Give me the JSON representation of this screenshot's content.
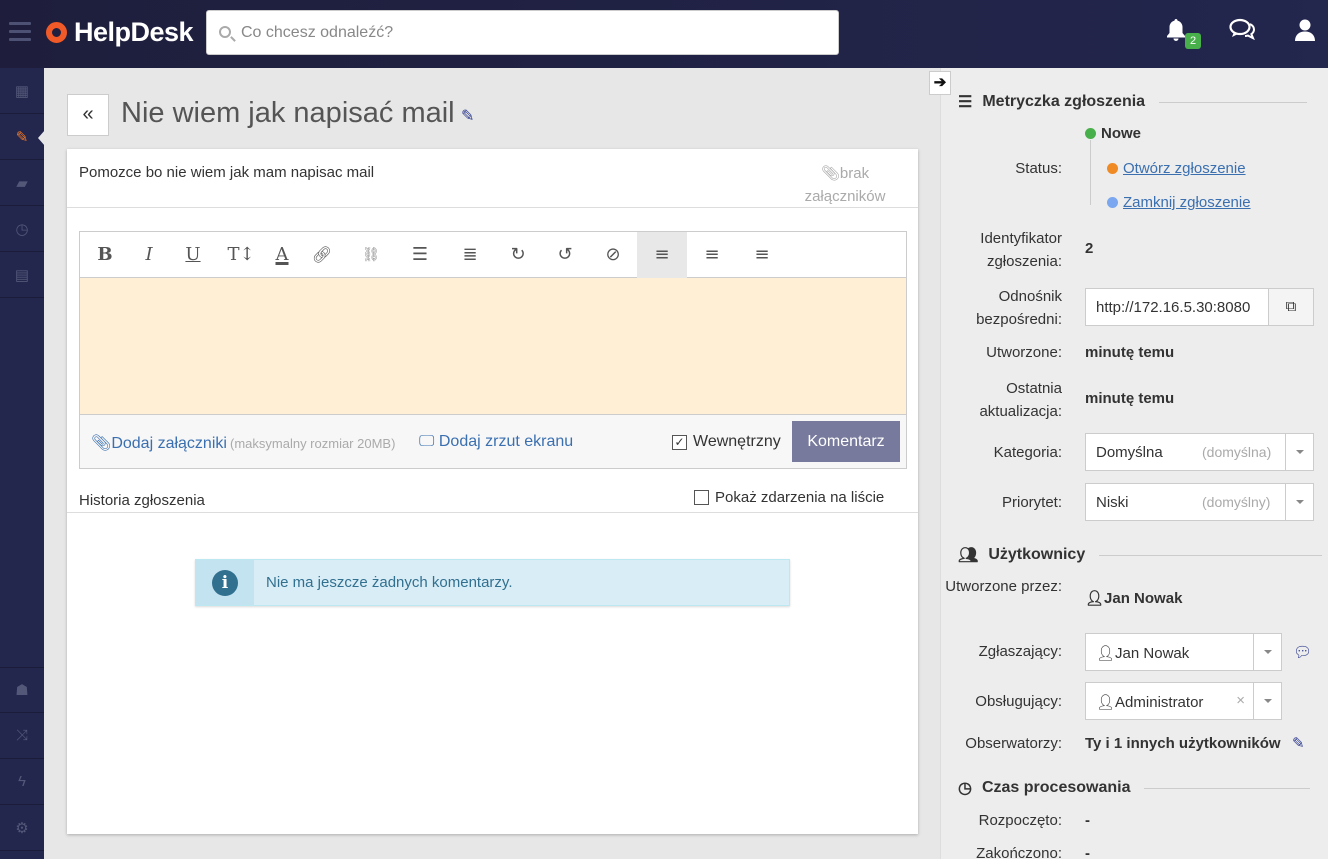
{
  "app": {
    "name": "HelpDesk",
    "notifications_count": "2"
  },
  "search": {
    "placeholder": "Co chcesz odnaleźć?"
  },
  "ticket": {
    "title": "Nie wiem jak napisać mail",
    "description": "Pomozce bo nie wiem jak mam napisac mail",
    "no_attachments": "brak załączników"
  },
  "editor": {
    "toolbar": [
      "B",
      "I",
      "U",
      "T↕",
      "A",
      "link",
      "unlink",
      "bullets",
      "numbers",
      "redo",
      "undo",
      "clear",
      "align-left",
      "align-center",
      "align-right"
    ],
    "add_attachments": "Dodaj załączniki",
    "max_size": "(maksymalny rozmiar 20MB)",
    "add_screenshot": "Dodaj zrzut ekranu",
    "internal_label": "Wewnętrzny",
    "internal_checked": true,
    "comment_button": "Komentarz"
  },
  "history": {
    "label": "Historia zgłoszenia",
    "show_events": "Pokaż zdarzenia na liście",
    "empty_message": "Nie ma jeszcze żadnych komentarzy."
  },
  "metrics": {
    "heading": "Metryczka zgłoszenia",
    "status_label": "Status:",
    "status_current": "Nowe",
    "status_open": "Otwórz zgłoszenie",
    "status_close": "Zamknij zgłoszenie",
    "id_label": "Identyfikator zgłoszenia:",
    "id_value": "2",
    "link_label": "Odnośnik bezpośredni:",
    "link_value": "http://172.16.5.30:8080",
    "created_label": "Utworzone:",
    "created_value": "minutę temu",
    "updated_label": "Ostatnia aktualizacja:",
    "updated_value": "minutę temu",
    "category_label": "Kategoria:",
    "category_value": "Domyślna",
    "category_hint": "(domyślna)",
    "priority_label": "Priorytet:",
    "priority_value": "Niski",
    "priority_hint": "(domyślny)"
  },
  "users": {
    "heading": "Użytkownicy",
    "created_by_label": "Utworzone przez:",
    "created_by_value": "Jan Nowak",
    "reporter_label": "Zgłaszający:",
    "reporter_value": "Jan Nowak",
    "handler_label": "Obsługujący:",
    "handler_value": "Administrator",
    "observers_label": "Obserwatorzy:",
    "observers_value": "Ty i 1 innych użytkowników"
  },
  "processing": {
    "heading": "Czas procesowania",
    "started_label": "Rozpoczęto:",
    "started_value": "-",
    "ended_label": "Zakończono:",
    "ended_value": "-"
  },
  "colors": {
    "accent": "#f05a28",
    "status_new": "#48b04a",
    "status_open": "#f08a24",
    "status_close": "#7aa7f0"
  }
}
